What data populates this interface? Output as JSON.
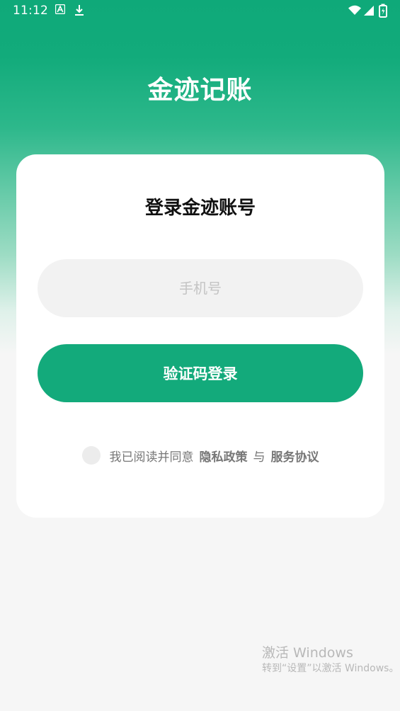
{
  "status_bar": {
    "time": "11:12",
    "left_icons": [
      "a-notification-icon",
      "download-icon"
    ],
    "right_icons": [
      "wifi-icon",
      "cellular-icon",
      "battery-icon"
    ]
  },
  "app": {
    "title": "金迹记账"
  },
  "login_card": {
    "title": "登录金迹账号",
    "phone_input": {
      "placeholder": "手机号",
      "value": ""
    },
    "login_button_label": "验证码登录",
    "agreement": {
      "checked": false,
      "text": "我已阅读并同意",
      "privacy_link": "隐私政策",
      "joiner": "与",
      "service_link": "服务协议"
    }
  },
  "watermark": {
    "title": "激活 Windows",
    "subtitle": "转到“设置”以激活 Windows。"
  },
  "colors": {
    "brand_green": "#13aa7b",
    "background": "#f6f6f6",
    "card": "#ffffff",
    "input_bg": "#f2f2f2",
    "checkbox_bg": "#ececec"
  }
}
